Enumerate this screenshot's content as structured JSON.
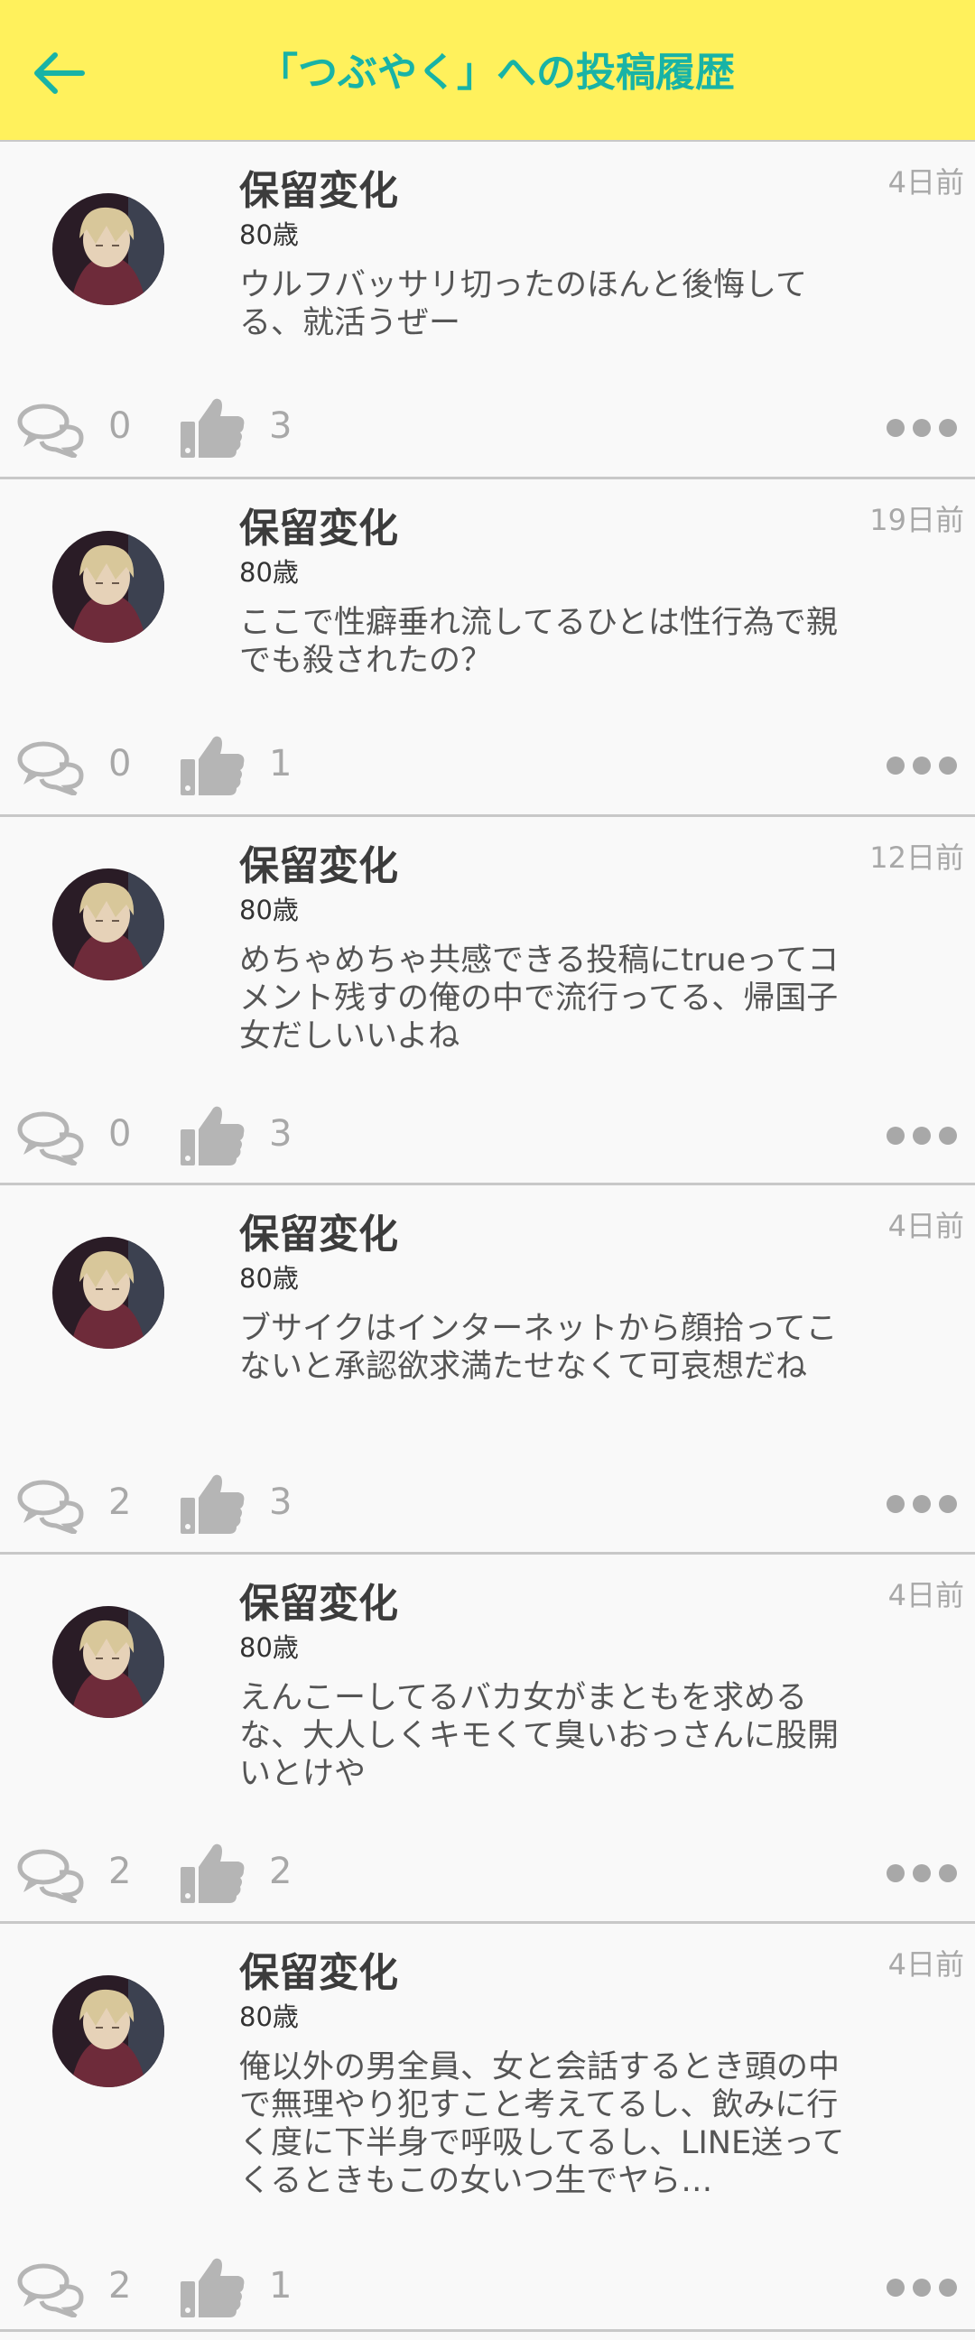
{
  "header": {
    "title": "「つぶやく」への投稿履歴",
    "back_icon": "back-arrow-icon",
    "background": "#fff15c",
    "title_color": "#18b3a6"
  },
  "posts": [
    {
      "name": "保留変化",
      "age": "80歳",
      "time": "4日前",
      "text": "ウルフバッサリ切ったのほんと後悔してる、就活うぜー",
      "comments": "0",
      "likes": "3"
    },
    {
      "name": "保留変化",
      "age": "80歳",
      "time": "19日前",
      "text": "ここで性癖垂れ流してるひとは性行為で親でも殺されたの？",
      "comments": "0",
      "likes": "1"
    },
    {
      "name": "保留変化",
      "age": "80歳",
      "time": "12日前",
      "text": "めちゃめちゃ共感できる投稿にtrueってコメント残すの俺の中で流行ってる、帰国子女だしいいよね",
      "comments": "0",
      "likes": "3"
    },
    {
      "name": "保留変化",
      "age": "80歳",
      "time": "4日前",
      "text": "ブサイクはインターネットから顔拾ってこないと承認欲求満たせなくて可哀想だね",
      "comments": "2",
      "likes": "3"
    },
    {
      "name": "保留変化",
      "age": "80歳",
      "time": "4日前",
      "text": "えんこーしてるバカ女がまともを求めるな、大人しくキモくて臭いおっさんに股開いとけや",
      "comments": "2",
      "likes": "2"
    },
    {
      "name": "保留変化",
      "age": "80歳",
      "time": "4日前",
      "text": "俺以外の男全員、女と会話するとき頭の中で無理やり犯すこと考えてるし、飲みに行く度に下半身で呼吸してるし、LINE送ってくるときもこの女いつ生でヤら…",
      "comments": "2",
      "likes": "1"
    }
  ],
  "icons": {
    "comment": "comment-bubbles-icon",
    "like": "thumbs-up-icon",
    "more": "more-dots-icon",
    "avatar": "avatar"
  },
  "colors": {
    "muted": "#a8a8a8",
    "divider": "#c8c8c8",
    "background": "#f9f9f9"
  }
}
